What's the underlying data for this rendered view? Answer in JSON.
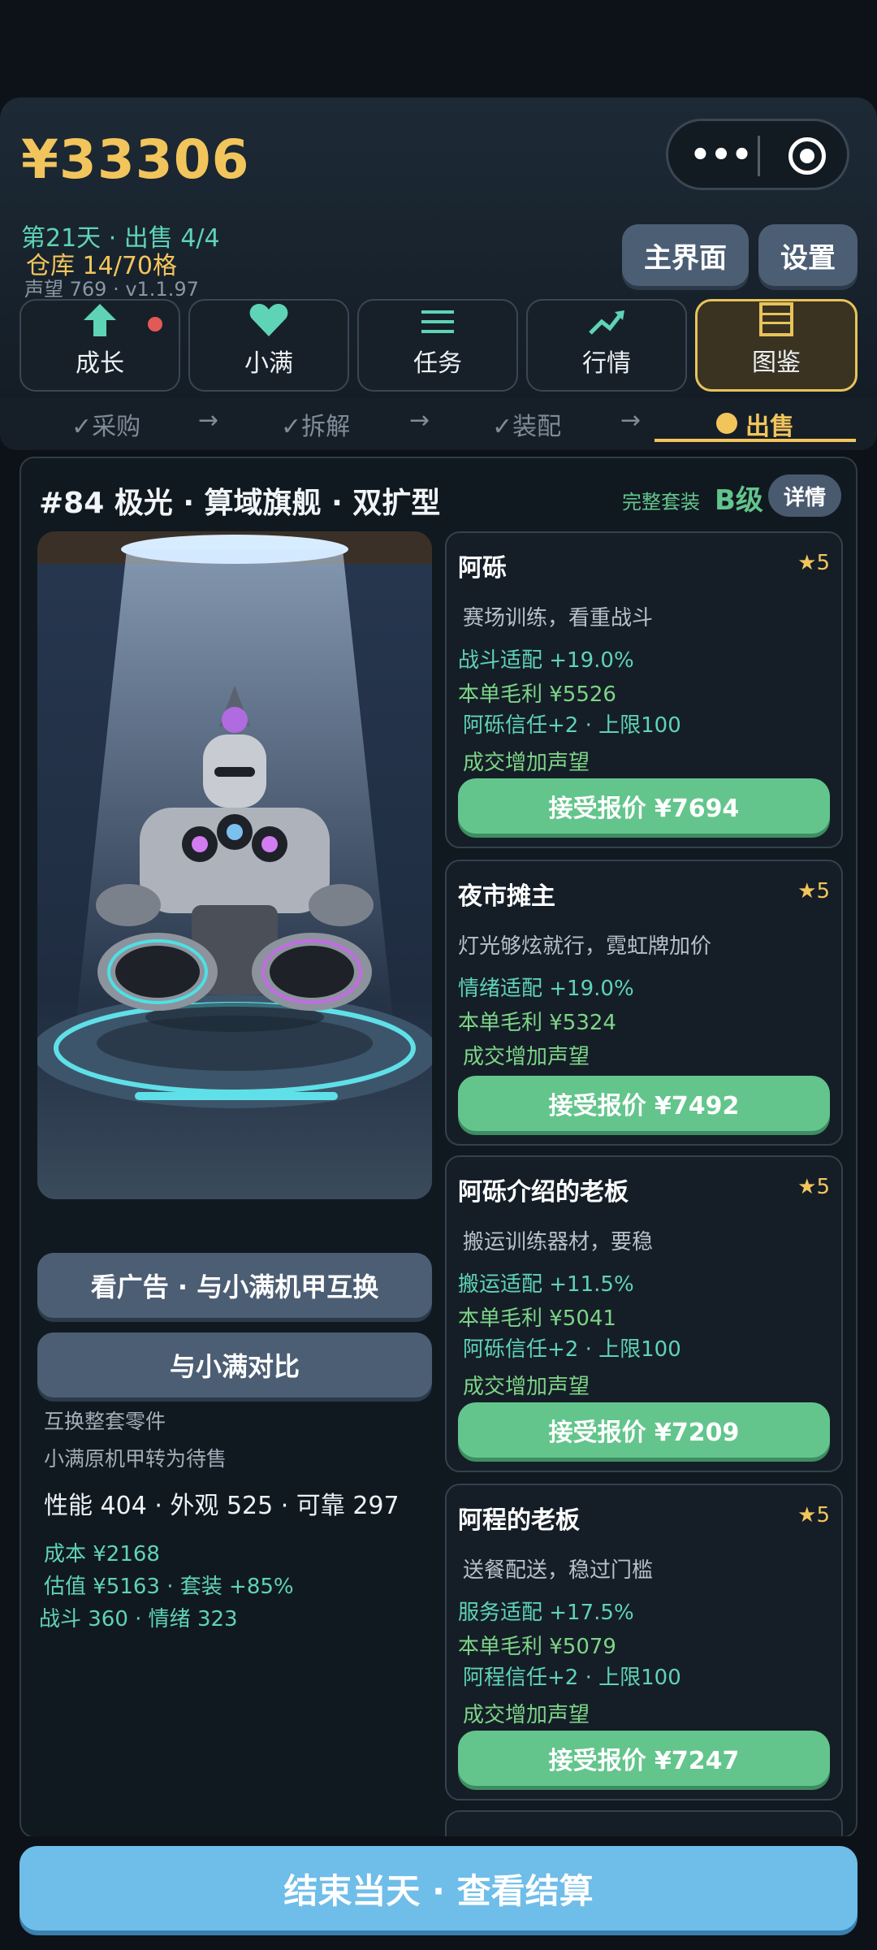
{
  "header": {
    "money": "¥33306",
    "day_sales": "第21天 · 出售 4/4",
    "warehouse": "仓库 14/70格",
    "reputation_version": "声望 769 · v1.1.97",
    "main_button": "主界面",
    "settings_button": "设置",
    "menu_dots": "•••"
  },
  "nav": [
    {
      "label": "成长",
      "icon": "arrow-up-icon"
    },
    {
      "label": "小满",
      "icon": "heart-icon"
    },
    {
      "label": "任务",
      "icon": "list-icon"
    },
    {
      "label": "行情",
      "icon": "trend-icon"
    },
    {
      "label": "图鉴",
      "icon": "book-icon"
    }
  ],
  "steps": {
    "s1": "✓采购",
    "s2": "✓拆解",
    "s3": "✓装配",
    "s4": "出售",
    "arrow": "→"
  },
  "panel": {
    "title": "#84 极光 · 算域旗舰 · 双扩型",
    "suit": "完整套装",
    "grade": "B级",
    "detail": "详情",
    "swap_button": "看广告 · 与小满机甲互换",
    "compare_button": "与小满对比",
    "note1": "互换整套零件",
    "note2": "小满原机甲转为待售",
    "stats": "性能 404 · 外观 525 · 可靠 297",
    "cost": "成本 ¥2168",
    "estimate": "估值 ¥5163 · 套装 +85%",
    "combat": "战斗 360 · 情绪 323"
  },
  "offers": [
    {
      "name": "阿砾",
      "stars": "★5",
      "desc": "赛场训练，看重战斗",
      "fit": "战斗适配 +19.0%",
      "profit": "本单毛利 ¥5526",
      "trust": "阿砾信任+2 · 上限100",
      "rep": "成交增加声望",
      "accept": "接受报价 ¥7694"
    },
    {
      "name": "夜市摊主",
      "stars": "★5",
      "desc": "灯光够炫就行，霓虹牌加价",
      "fit": "情绪适配 +19.0%",
      "profit": "本单毛利 ¥5324",
      "trust": "",
      "rep": "成交增加声望",
      "accept": "接受报价 ¥7492"
    },
    {
      "name": "阿砾介绍的老板",
      "stars": "★5",
      "desc": "搬运训练器材，要稳",
      "fit": "搬运适配 +11.5%",
      "profit": "本单毛利 ¥5041",
      "trust": "阿砾信任+2 · 上限100",
      "rep": "成交增加声望",
      "accept": "接受报价 ¥7209"
    },
    {
      "name": "阿程的老板",
      "stars": "★5",
      "desc": "送餐配送，稳过门槛",
      "fit": "服务适配 +17.5%",
      "profit": "本单毛利 ¥5079",
      "trust": "阿程信任+2 · 上限100",
      "rep": "成交增加声望",
      "accept": "接受报价 ¥7247"
    }
  ],
  "end_button": "结束当天 · 查看结算"
}
